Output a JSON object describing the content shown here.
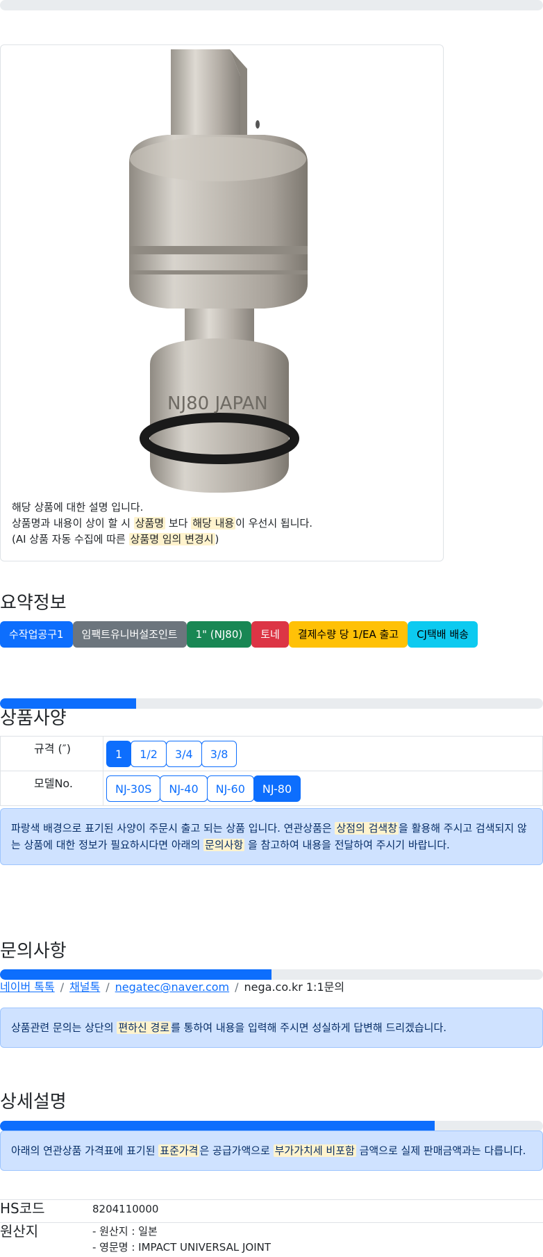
{
  "progress_top": {
    "value_percent": 100
  },
  "product_card": {
    "image_name": "impact-universal-joint-photo",
    "image_text": "NJ80 JAPAN",
    "desc_line1": "해당 상품에 대한 설명 입니다.",
    "desc_line2_a": "상품명과 내용이 상이 할 시 ",
    "desc_line2_hl1": "상품명",
    "desc_line2_b": " 보다 ",
    "desc_line2_hl2": "해당 내용",
    "desc_line2_c": "이 우선시 됩니다.",
    "desc_line3_a": "(AI 상품 자동 수집에 따른 ",
    "desc_line3_hl": "상품명 임의 변경시",
    "desc_line3_b": ")"
  },
  "summary": {
    "title": "요약정보",
    "badges": [
      {
        "label": "수작업공구1",
        "color": "#0d6efd",
        "text_color": "#ffffff"
      },
      {
        "label": "임팩트유니버설조인트",
        "color": "#6c757d",
        "text_color": "#ffffff"
      },
      {
        "label": "1\" (NJ80)",
        "color": "#198754",
        "text_color": "#ffffff"
      },
      {
        "label": "토네",
        "color": "#dc3545",
        "text_color": "#ffffff"
      },
      {
        "label": "결제수량 당 1/EA 출고",
        "color": "#ffc107",
        "text_color": "#000000"
      },
      {
        "label": "CJ택배 배송",
        "color": "#0dcaf0",
        "text_color": "#000000"
      }
    ]
  },
  "spec": {
    "progress_percent": 25,
    "title": "상품사양",
    "rows": [
      {
        "key": "규격 (″)",
        "options": [
          "1",
          "1/2",
          "3/4",
          "3/8"
        ],
        "selected": 0
      },
      {
        "key": "모델No.",
        "options": [
          "NJ-30S",
          "NJ-40",
          "NJ-60",
          "NJ-80"
        ],
        "selected": 3
      }
    ],
    "alert_a": "파랑색 배경으로 표기된 사양이 주문시 출고 되는 상품 입니다. 연관상품은 ",
    "alert_hl1": "상점의 검색창",
    "alert_b": "을 활용해 주시고 검색되지 않는 상품에 대한 정보가 필요하시다면 아래의 ",
    "alert_hl2": "문의사항",
    "alert_c": " 을 참고하여 내용을 전달하여 주시기 바랍니다."
  },
  "inquiry": {
    "title": "문의사항",
    "progress_percent": 50,
    "link1": "네이버 톡톡",
    "link2": "채널톡",
    "link3": "negatec@naver.com",
    "text4": "nega.co.kr 1:1문의",
    "separator": "/",
    "alert_a": "상품관련 문의는 상단의 ",
    "alert_hl": "편하신 경로",
    "alert_b": "를 통하여 내용을 입력해 주시면 성실하게 답변해 드리겠습니다."
  },
  "detail": {
    "title": "상세설명",
    "progress_percent": 80,
    "alert_a": "아래의 연관상품 가격표에 표기된 ",
    "alert_hl1": "표준가격",
    "alert_b": "은 공급가액으로 ",
    "alert_hl2": "부가가치세 비포함",
    "alert_c": " 금액으로 실제 판매금액과는 다릅니다.",
    "hs_label": "HS코드",
    "hs_value": "8204110000",
    "origin_label": "원산지",
    "origin_line1": "- 원산지 : 일본",
    "origin_line2": "- 영문명 : IMPACT UNIVERSAL JOINT"
  }
}
